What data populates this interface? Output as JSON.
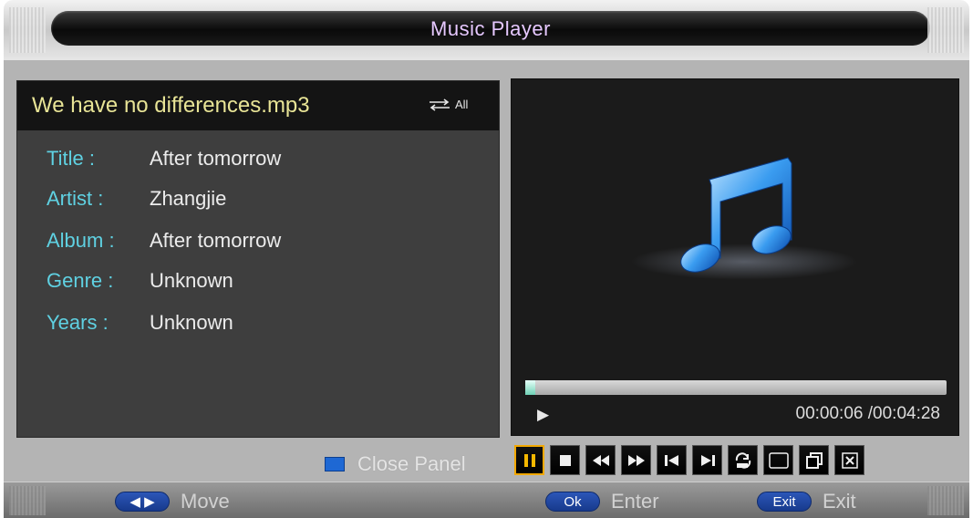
{
  "header": {
    "title": "Music Player"
  },
  "file": {
    "name": "We have no differences.mp3",
    "repeat_mode": "All"
  },
  "info": [
    {
      "label": "Title :",
      "value": "After tomorrow"
    },
    {
      "label": "Artist :",
      "value": "Zhangjie"
    },
    {
      "label": "Album :",
      "value": "After tomorrow"
    },
    {
      "label": "Genre :",
      "value": "Unknown"
    },
    {
      "label": "Years :",
      "value": "Unknown"
    }
  ],
  "playback": {
    "state_icon": "play-icon",
    "time": "00:00:06 /00:04:28",
    "progress_fraction": 0.023
  },
  "close_panel": {
    "label": "Close Panel",
    "color": "#1e68d4"
  },
  "controls": [
    {
      "name": "pause-icon",
      "active": true
    },
    {
      "name": "stop-icon",
      "active": false
    },
    {
      "name": "rewind-icon",
      "active": false
    },
    {
      "name": "fast-forward-icon",
      "active": false
    },
    {
      "name": "previous-icon",
      "active": false
    },
    {
      "name": "next-icon",
      "active": false
    },
    {
      "name": "repeat-icon",
      "active": false
    },
    {
      "name": "repeat-all-icon",
      "label": "All",
      "active": false
    },
    {
      "name": "playlist-icon",
      "active": false
    },
    {
      "name": "close-icon",
      "active": false
    }
  ],
  "footer": {
    "move": {
      "key_icon": "left-right-arrows-icon",
      "label": "Move"
    },
    "enter": {
      "key": "Ok",
      "label": "Enter"
    },
    "exit": {
      "key": "Exit",
      "label": "Exit"
    }
  },
  "colors": {
    "label_cyan": "#5fd1e2",
    "filename_yellow": "#e8e496",
    "title_lilac": "#e6c8ff",
    "accent_orange": "#f2a800"
  }
}
